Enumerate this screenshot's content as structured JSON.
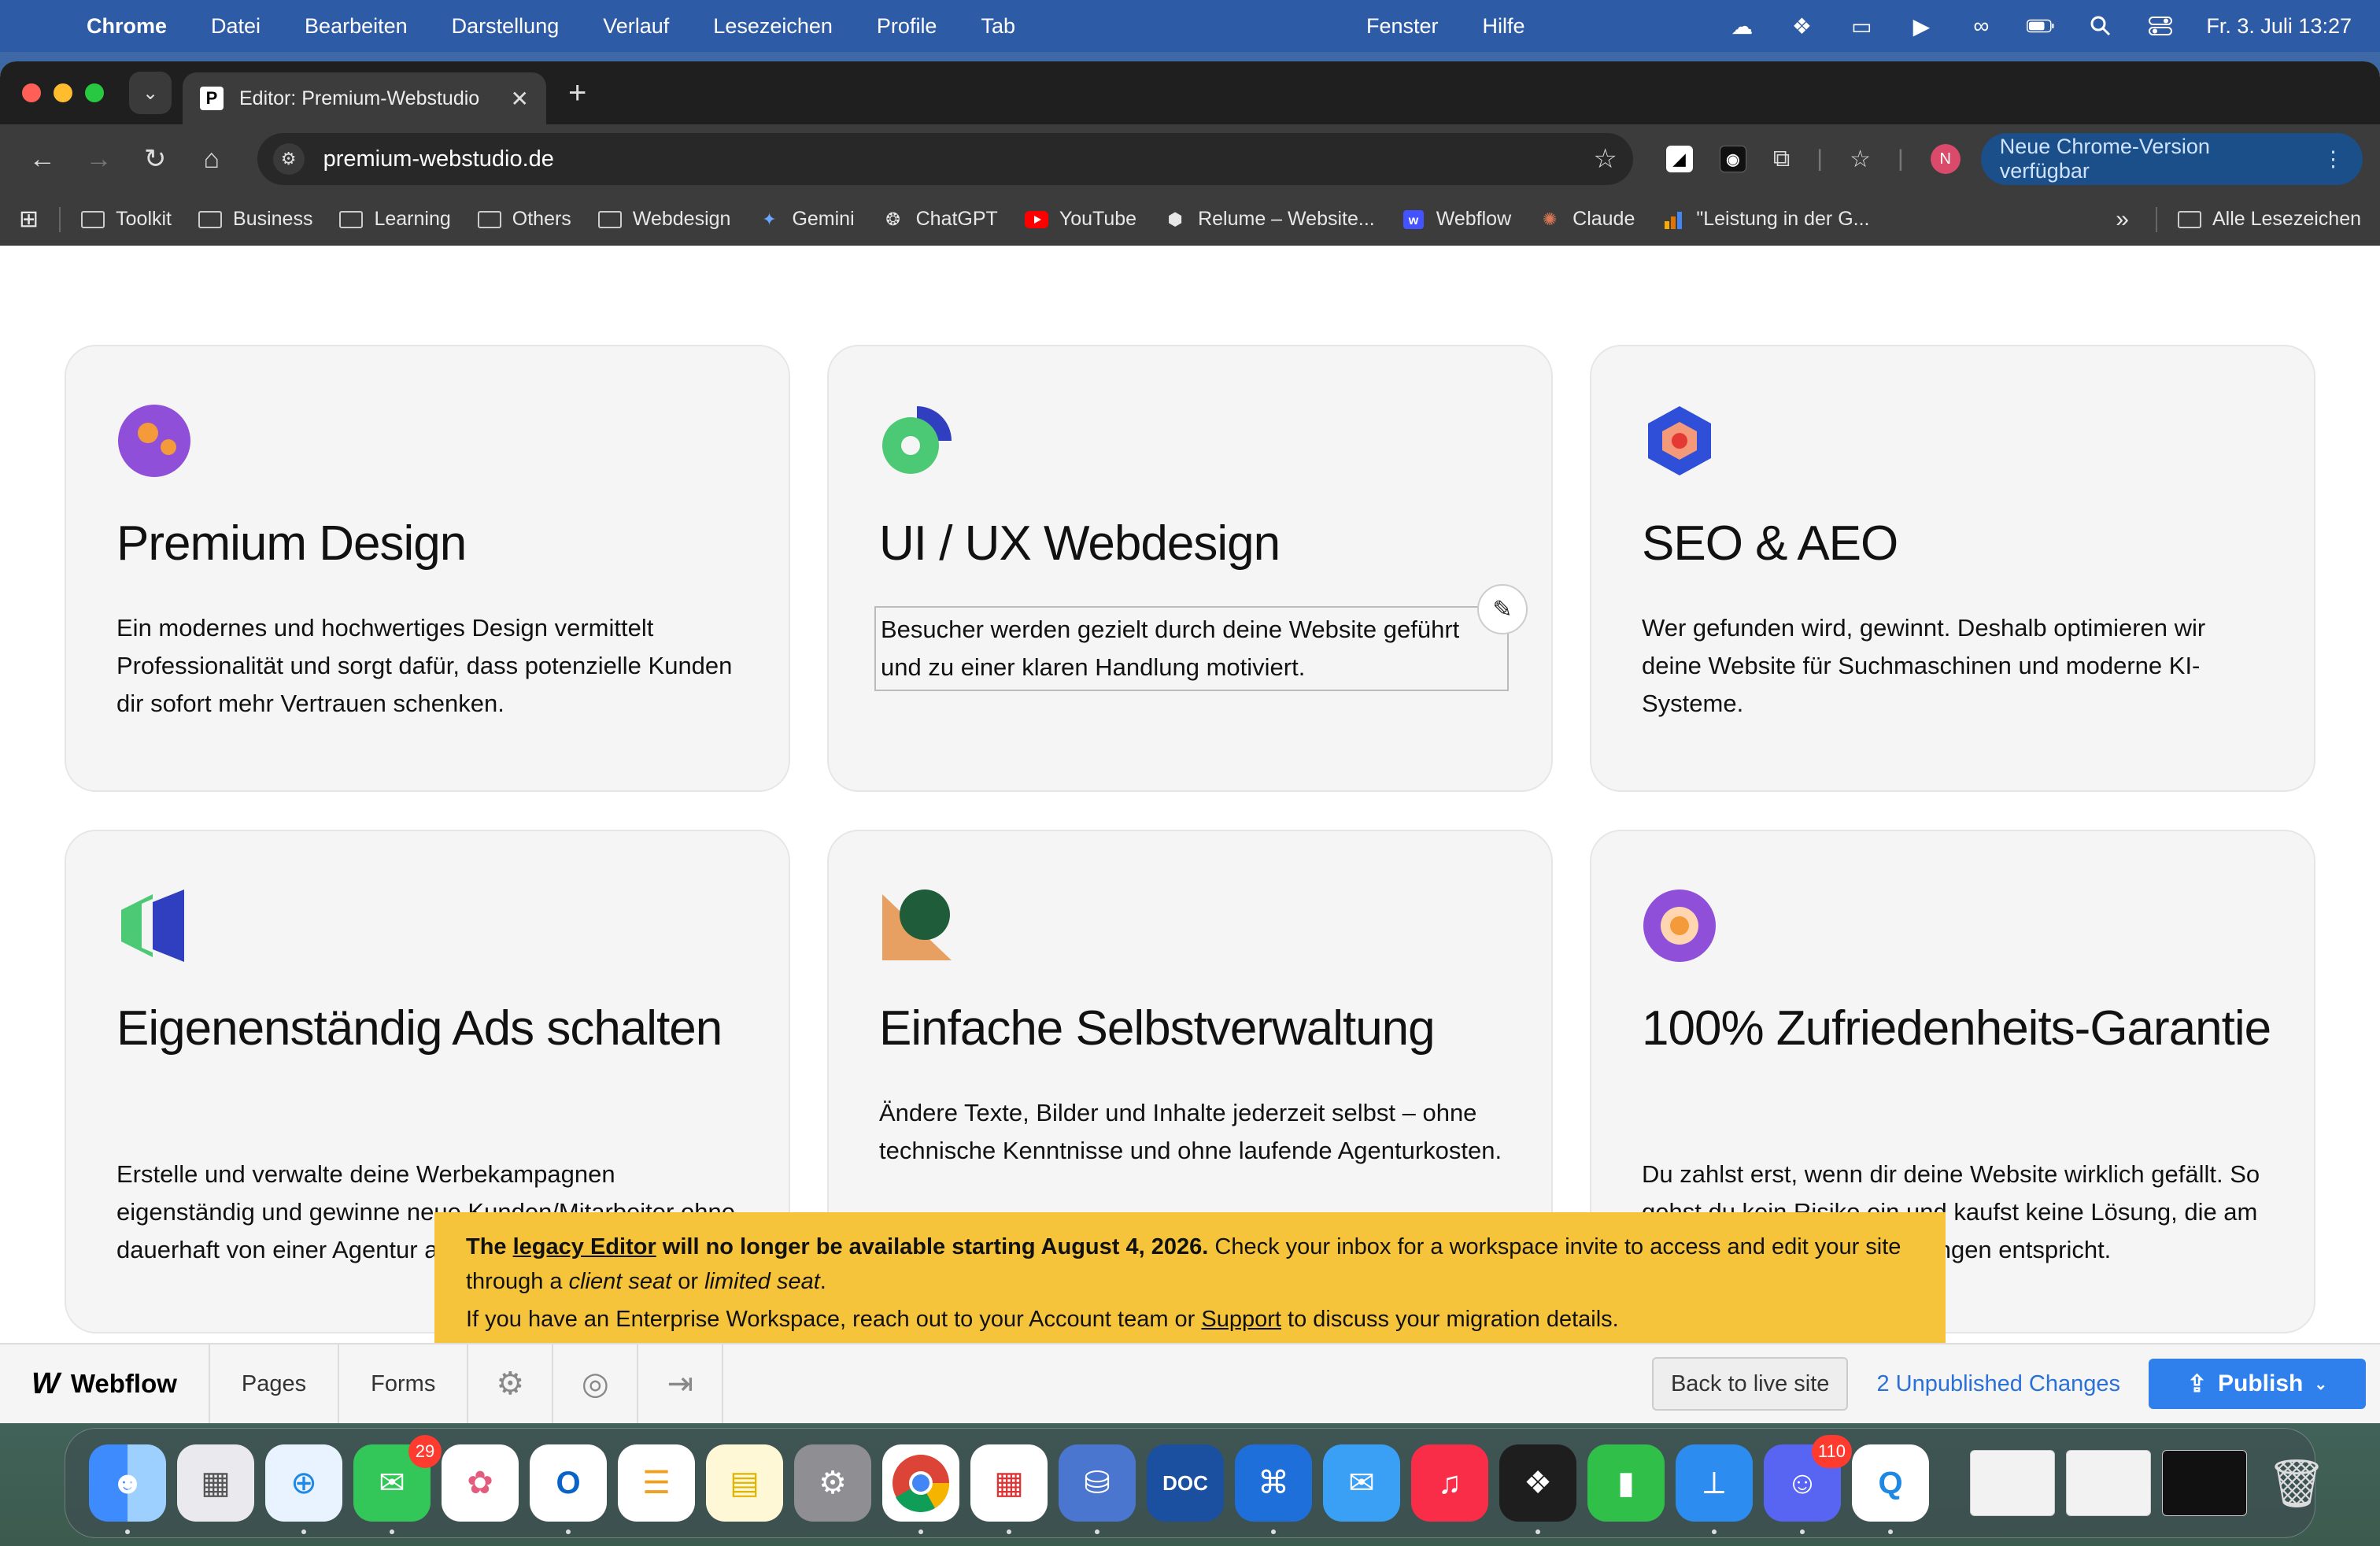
{
  "menubar": {
    "app": "Chrome",
    "menus": [
      "Datei",
      "Bearbeiten",
      "Darstellung",
      "Verlauf",
      "Lesezeichen",
      "Profile",
      "Tab"
    ],
    "center_menus": [
      "Fenster",
      "Hilfe"
    ],
    "datetime": "Fr. 3. Juli  13:27"
  },
  "browser": {
    "tab_title": "Editor: Premium-Webstudio",
    "tab_favicon": "P",
    "url": "premium-webstudio.de",
    "update_label": "Neue Chrome-Version verfügbar",
    "avatar": "N"
  },
  "bookmarks": {
    "items": [
      {
        "label": "Toolkit",
        "icon": "folder-icon"
      },
      {
        "label": "Business",
        "icon": "folder-icon"
      },
      {
        "label": "Learning",
        "icon": "folder-icon"
      },
      {
        "label": "Others",
        "icon": "folder-icon"
      },
      {
        "label": "Webdesign",
        "icon": "folder-icon"
      },
      {
        "label": "Gemini",
        "icon": "gemini-icon"
      },
      {
        "label": "ChatGPT",
        "icon": "chatgpt-icon"
      },
      {
        "label": "YouTube",
        "icon": "youtube-icon"
      },
      {
        "label": "Relume – Website...",
        "icon": "relume-icon"
      },
      {
        "label": "Webflow",
        "icon": "webflow-icon"
      },
      {
        "label": "Claude",
        "icon": "claude-icon"
      },
      {
        "label": "\"Leistung in der G...",
        "icon": "analytics-icon"
      }
    ],
    "all_bookmarks": "Alle Lesezeichen"
  },
  "cards": [
    {
      "title": "Premium Design",
      "desc": "Ein modernes und hochwertiges Design vermittelt Professionalität und sorgt dafür, dass potenzielle Kunden dir sofort mehr Vertrauen schenken."
    },
    {
      "title": "UI / UX Webdesign",
      "desc": "Besucher werden gezielt durch deine Website geführt und zu einer klaren Handlung motiviert."
    },
    {
      "title": "SEO & AEO",
      "desc": "Wer gefunden wird, gewinnt. Deshalb optimieren wir deine Website für Suchmaschinen und moderne KI-Systeme."
    },
    {
      "title": "Eigenenständig Ads schalten",
      "desc": "Erstelle und verwalte deine Werbekampagnen eigenständig und gewinne neue Kunden/Mitarbeiter ohne dauerhaft von einer Agentur abhängig zu sein."
    },
    {
      "title": "Einfache Selbstverwaltung",
      "desc": "Ändere Texte, Bilder und Inhalte jederzeit selbst – ohne technische Kenntnisse und ohne laufende Agenturkosten."
    },
    {
      "title": "100% Zufriedenheits-Garantie",
      "desc": "Du zahlst erst, wenn dir deine Website wirklich gefällt. So gehst du kein Risiko ein und kaufst keine Lösung, die am Ende nicht deinen Vorstellungen entspricht."
    }
  ],
  "banner": {
    "part1": "The ",
    "link1": "legacy Editor",
    "part2": " will no longer be available starting August 4, 2026.",
    "part3": " Check your inbox for a workspace invite to access and edit your site through a ",
    "em1": "client seat",
    "part4": " or ",
    "em2": "limited seat",
    "part5": ".",
    "line2a": "If you have an Enterprise Workspace, reach out to your Account team or ",
    "link2": "Support",
    "line2b": " to discuss your migration details."
  },
  "webflow_bar": {
    "brand": "Webflow",
    "tabs": [
      "Pages",
      "Forms"
    ],
    "back_label": "Back to live site",
    "unpublished": "2 Unpublished Changes",
    "publish": "Publish"
  },
  "dock": {
    "messages_badge": "29",
    "discord_badge": "110",
    "doc_label": "DOC"
  },
  "colors": {
    "publish_blue": "#2f80ed",
    "banner_yellow": "#f6c43a",
    "card_bg": "#f5f5f5"
  }
}
